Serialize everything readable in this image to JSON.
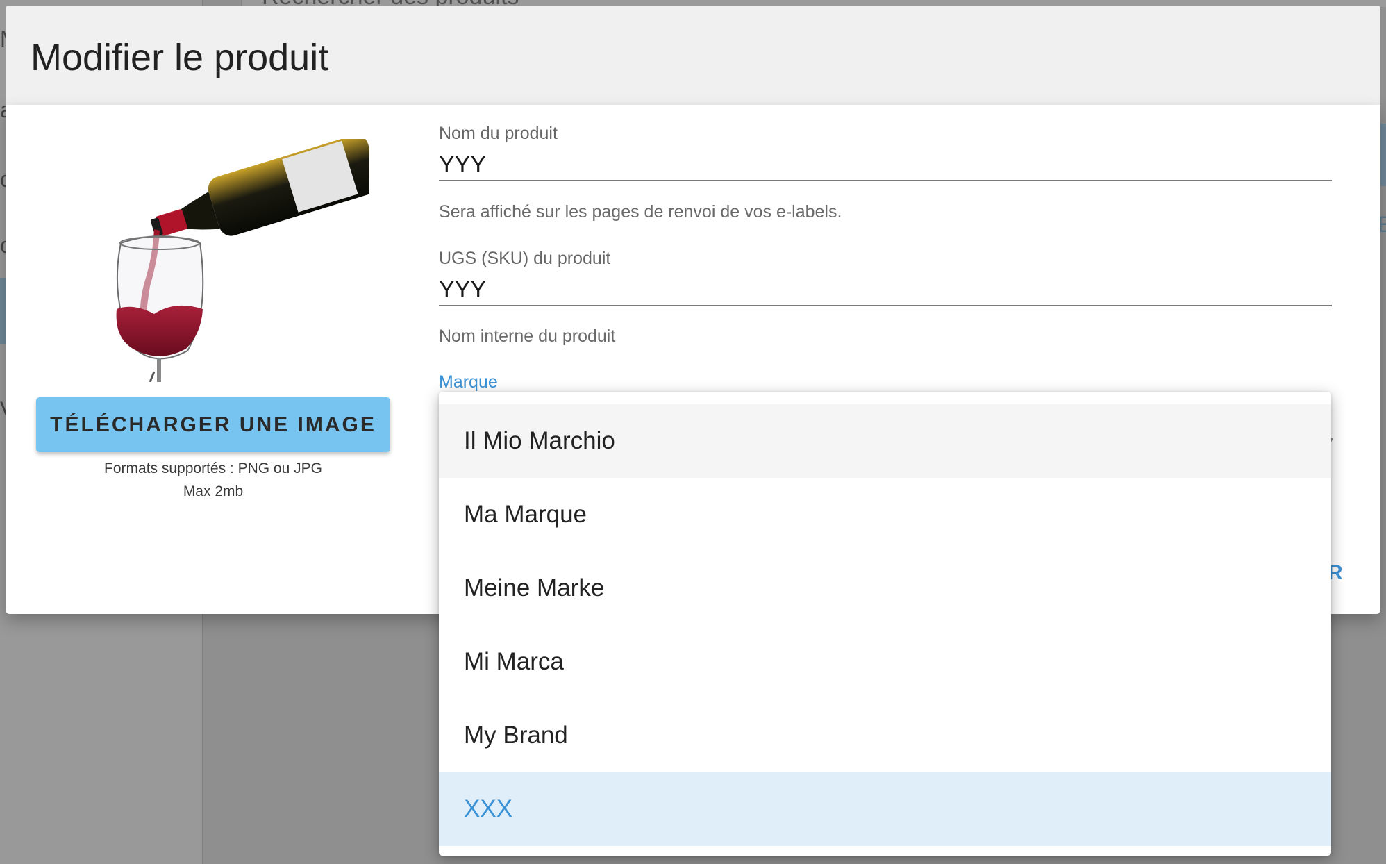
{
  "background": {
    "search_placeholder": "Rechercher des produits",
    "left_fragments": [
      "M",
      "a",
      "c",
      "o",
      "V"
    ],
    "right_fragment": "E"
  },
  "dialog": {
    "title": "Modifier le produit",
    "image": {
      "alt": "wine-bottle-pouring-into-glass",
      "upload_button_label": "TÉLÉCHARGER UNE IMAGE",
      "formats_hint": "Formats supportés : PNG ou JPG",
      "size_hint": "Max 2mb"
    },
    "fields": {
      "product_name": {
        "label": "Nom du produit",
        "value": "YYY",
        "help": "Sera affiché sur les pages de renvoi de vos e-labels."
      },
      "product_sku": {
        "label": "UGS (SKU) du produit",
        "value": "YYY",
        "help": "Nom interne du produit"
      },
      "brand": {
        "label": "Marque",
        "selected": "XXX"
      }
    },
    "partial_action_label": "R"
  },
  "dropdown": {
    "options": [
      {
        "label": "Il Mio Marchio",
        "state": "hover"
      },
      {
        "label": "Ma Marque",
        "state": "normal"
      },
      {
        "label": "Meine Marke",
        "state": "normal"
      },
      {
        "label": "Mi Marca",
        "state": "normal"
      },
      {
        "label": "My Brand",
        "state": "normal"
      },
      {
        "label": "XXX",
        "state": "selected"
      }
    ]
  },
  "colors": {
    "accent": "#3a92d6",
    "upload_button": "#78c4f0",
    "selected_option_bg": "#e0eef9",
    "header_bg": "#f0f0f0",
    "overlay": "#8f8f8f"
  }
}
